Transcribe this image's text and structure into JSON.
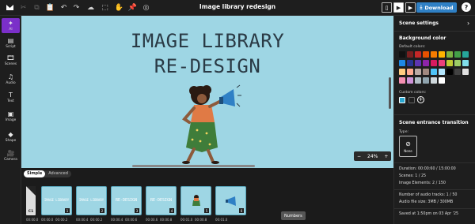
{
  "document": {
    "title": "Image library redesign"
  },
  "toolbar": {
    "download_label": "Download",
    "help_label": "?"
  },
  "sidebar": {
    "items": [
      {
        "label": "AI",
        "icon": "magic-wand-icon"
      },
      {
        "label": "Script",
        "icon": "script-icon"
      },
      {
        "label": "Scenes",
        "icon": "film-icon"
      },
      {
        "label": "Audio",
        "icon": "music-note-icon"
      },
      {
        "label": "Text",
        "icon": "text-icon"
      },
      {
        "label": "Image",
        "icon": "image-icon"
      },
      {
        "label": "Shape",
        "icon": "shape-icon"
      },
      {
        "label": "Camera",
        "icon": "camera-icon"
      }
    ]
  },
  "canvas": {
    "line1": "IMAGE LIBRARY",
    "line2": "RE-DESIGN",
    "zoom": "24%",
    "zoom_minus": "−",
    "zoom_plus": "+",
    "background_color": "#9ed6e4"
  },
  "modes": {
    "simple": "Simple",
    "advanced": "Advanced"
  },
  "timeline": {
    "start_label": "C1",
    "scenes": [
      {
        "num": "1",
        "text": "IMAGE LIBRARY"
      },
      {
        "num": "2",
        "text": "IMAGE LIBRARY"
      },
      {
        "num": "3",
        "text": "RE-DESIGN"
      },
      {
        "num": "4",
        "text": "RE-DESIGN"
      },
      {
        "num": "5",
        "text": ""
      },
      {
        "num": "6",
        "text": ""
      }
    ],
    "times": [
      "00:00.0",
      "00:00.0",
      "00:00.2",
      "00:00.4",
      "00:00.2",
      "00:00.4",
      "00:00.6",
      "00:00.6",
      "00:00.8",
      "00:01.0",
      "00:00.8",
      "00:01.0"
    ],
    "tooltip": "Numbers"
  },
  "panel": {
    "title": "Scene settings",
    "bg_heading": "Background color",
    "default_colors_label": "Default colors:",
    "default_colors": [
      "#111111",
      "#7a1f1f",
      "#c62828",
      "#e65100",
      "#f57c00",
      "#ffb300",
      "#7cb342",
      "#43a047",
      "#26a69a",
      "#1e88e5",
      "#283593",
      "#5e35b1",
      "#8e24aa",
      "#d81b60",
      "#ec407a",
      "#c0ca33",
      "#9ccc65",
      "#80deea",
      "#ffcc80",
      "#ffab91",
      "#bcaaa4",
      "#a1887f",
      "#4fc3f7",
      "#b3e5fc",
      "#000000",
      "#424242",
      "#e0e0e0",
      "#f48fb1",
      "#ce93d8",
      "#b0bec5",
      "#90a4ae",
      "#cfd8dc",
      "#ffffff"
    ],
    "custom_colors_label": "Custom colors:",
    "custom_colors": [
      "#2aa7d0",
      "#1e1e1e"
    ],
    "transition_heading": "Scene entrance transition",
    "type_label": "Type:",
    "type_value": "None",
    "stats": [
      "Duration: 00:00:60 / 15:00:00",
      "Scenes: 1 / 25",
      "Image Elements: 2 / 150",
      "Number of audio tracks: 1 / 50",
      "Audio file size: 3MB / 300MB",
      "Saved at 1:50pm on 03 Apr '25"
    ]
  }
}
